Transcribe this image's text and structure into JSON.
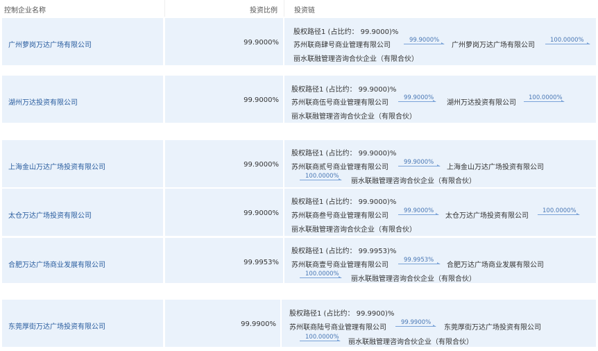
{
  "headers": {
    "company": "控制企业名称",
    "ratio": "投资比例",
    "chain": "投资链"
  },
  "rows": [
    {
      "company": "广州萝岗万达广场有限公司",
      "ratio": "99.9000%",
      "chain_title": "股权路径1 (占比约： 99.9000)%",
      "nodes": [
        "苏州联商肆号商业管理有限公司",
        "广州萝岗万达广场有限公司",
        "丽水联融管理咨询合伙企业（有限合伙）"
      ],
      "links": [
        "99.9000%",
        "100.0000%"
      ]
    },
    {
      "company": "湖州万达投资有限公司",
      "ratio": "99.9000%",
      "chain_title": "股权路径1 (占比约： 99.9000)%",
      "nodes": [
        "苏州联商伍号商业管理有限公司",
        "湖州万达投资有限公司",
        "丽水联融管理咨询合伙企业（有限合伙）"
      ],
      "links": [
        "99.9000%",
        "100.0000%"
      ]
    },
    {
      "company": "上海金山万达广场投资有限公司",
      "ratio": "99.9000%",
      "chain_title": "股权路径1 (占比约： 99.9000)%",
      "nodes": [
        "苏州联商贰号商业管理有限公司",
        "上海金山万达广场投资有限公司",
        "丽水联融管理咨询合伙企业（有限合伙）"
      ],
      "links": [
        "99.9000%",
        "100.0000%"
      ]
    },
    {
      "company": "太仓万达广场投资有限公司",
      "ratio": "99.9000%",
      "chain_title": "股权路径1 (占比约： 99.9000)%",
      "nodes": [
        "苏州联商叁号商业管理有限公司",
        "太仓万达广场投资有限公司",
        "丽水联融管理咨询合伙企业（有限合伙）"
      ],
      "links": [
        "99.9000%",
        "100.0000%"
      ]
    },
    {
      "company": "合肥万达广场商业发展有限公司",
      "ratio": "99.9953%",
      "chain_title": "股权路径1 (占比约： 99.9953)%",
      "nodes": [
        "苏州联商壹号商业管理有限公司",
        "合肥万达广场商业发展有限公司",
        "丽水联融管理咨询合伙企业（有限合伙）"
      ],
      "links": [
        "99.9953%",
        "100.0000%"
      ]
    },
    {
      "company": "东莞厚街万达广场投资有限公司",
      "ratio": "99.9900%",
      "chain_title": "股权路径1 (占比约： 99.9900)%",
      "nodes": [
        "苏州联商陆号商业管理有限公司",
        "东莞厚街万达广场投资有限公司",
        "丽水联融管理咨询合伙企业（有限合伙）"
      ],
      "links": [
        "99.9900%",
        "100.0000%"
      ]
    }
  ],
  "colors": {
    "row_bg": "#eaf2fb",
    "link_text": "#2a5d9f",
    "arrow": "#7aa3d8"
  }
}
